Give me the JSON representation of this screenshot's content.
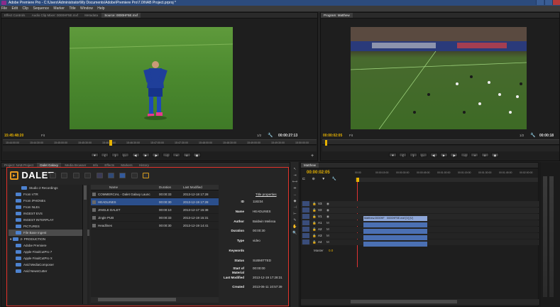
{
  "window": {
    "title": "Adobe Premiere Pro - C:\\Users\\Administrator\\My Documents\\Adobe\\Premiere Pro\\7.0\\NAB Project.prproj *"
  },
  "menu": [
    "File",
    "Edit",
    "Clip",
    "Sequence",
    "Marker",
    "Title",
    "Window",
    "Help"
  ],
  "source_monitor": {
    "tabs": [
      "Effect Controls",
      "Audio Clip Mixer: 0000HF5E.mxf",
      "Metadata",
      "Source: 0000HF5E.mxf"
    ],
    "timecode_left": "15:45:48:20",
    "timecode_right": "00:00:27:13",
    "fit_label": "Fit",
    "zoom_label": "1/2",
    "ruler_ticks": [
      "15:44:00:00",
      "15:44:30:00",
      "15:45:00:00",
      "15:45:30:00",
      "15:46:00:00",
      "15:46:30:00",
      "15:47:00:00",
      "15:47:30:00",
      "15:48:00:00",
      "15:48:30:00",
      "15:49:00:00",
      "15:49:30:00",
      "15:50:00:00"
    ]
  },
  "program_monitor": {
    "tab": "Program: Matthew",
    "timecode_left": "00:00:02:05",
    "timecode_right": "00:00:18",
    "fit_label": "Fit",
    "zoom_label": "1/2"
  },
  "project_panel": {
    "tabs": [
      "Project: NAB Project",
      "Dalet Galaxy",
      "Media Browser",
      "Info",
      "Effects",
      "Markers",
      "History"
    ],
    "logo": "DALET",
    "tree": [
      {
        "label": "Studio 2 Recordings",
        "indent": 2
      },
      {
        "label": "From VTR",
        "indent": 1
      },
      {
        "label": "From iPHONEs",
        "indent": 1
      },
      {
        "label": "From NLEs",
        "indent": 1
      },
      {
        "label": "INGEST EVS",
        "indent": 1
      },
      {
        "label": "INGEST INTERPLAY",
        "indent": 1
      },
      {
        "label": "PICTURES",
        "indent": 1
      },
      {
        "label": "File Base Ingest",
        "indent": 1,
        "selected": true
      },
      {
        "label": "2- PRODUCTION",
        "indent": 0
      },
      {
        "label": "Adobe Premiere",
        "indent": 1
      },
      {
        "label": "Apple FinalCutPro 7",
        "indent": 1
      },
      {
        "label": "Apple FinalCutPro X",
        "indent": 1
      },
      {
        "label": "Avid MediaComposer",
        "indent": 1
      },
      {
        "label": "Avid NewsCutter",
        "indent": 1
      }
    ],
    "columns": [
      "Name",
      "Duration",
      "Last Modified"
    ],
    "rows": [
      {
        "name": "COMMERCIAL - Dalet Galaxy Launc",
        "duration": "00:00:33",
        "modified": "2013-12-18 17:28",
        "selected": false
      },
      {
        "name": "HEADLINES",
        "duration": "00:00:30",
        "modified": "2013-12-19 17:28",
        "selected": true
      },
      {
        "name": "JINGLE DALET",
        "duration": "00:00:10",
        "modified": "2013-12-17 15:38",
        "selected": false
      },
      {
        "name": "Jingle PUB",
        "duration": "00:00:33",
        "modified": "2013-12-19 15:31",
        "selected": false
      },
      {
        "name": "Headlines",
        "duration": "00:00:30",
        "modified": "2013-12-19 14:41",
        "selected": false
      }
    ],
    "properties_title": "Title properties",
    "properties": [
      {
        "key": "ID",
        "value": "118234"
      },
      {
        "key": "Name",
        "value": "HEADLINES"
      },
      {
        "key": "Author",
        "value": "Baldwin Melissa"
      },
      {
        "key": "Duration",
        "value": "00:00:30"
      },
      {
        "key": "Type",
        "value": "video"
      },
      {
        "key": "Keywords",
        "value": ""
      },
      {
        "key": "Status",
        "value": "SUBMITTED"
      },
      {
        "key": "Start of Material",
        "value": "00:00:00"
      },
      {
        "key": "Last Modified",
        "value": "2013-12-19 17:28:31"
      },
      {
        "key": "Created",
        "value": "2013-06-11 10:57:39"
      }
    ]
  },
  "timeline": {
    "tab": "Matthew",
    "timecode": "00:00:02:05",
    "ruler_ticks": [
      "00:00",
      "00:00:15:00",
      "00:00:30:00",
      "00:00:45:00",
      "00:01:00:00",
      "00:01:15:00",
      "00:01:30:00",
      "00:01:45:00",
      "00:02:00:00"
    ],
    "tracks": [
      {
        "name": "V3",
        "type": "video"
      },
      {
        "name": "V2",
        "type": "video"
      },
      {
        "name": "V1",
        "type": "video"
      },
      {
        "name": "A1",
        "type": "audio"
      },
      {
        "name": "A2",
        "type": "audio"
      },
      {
        "name": "A3",
        "type": "audio"
      },
      {
        "name": "A4",
        "type": "audio"
      }
    ],
    "clip_v1_a": "Matthew.0000HF",
    "clip_v1_b": "0000HF5E.mxf [V] [V]",
    "master_label": "Master",
    "master_value": "0.0"
  },
  "colors": {
    "accent": "#e8b300",
    "selection": "#2b4f8c",
    "highlight_border": "#e0322a",
    "folder": "#4d82cf"
  }
}
